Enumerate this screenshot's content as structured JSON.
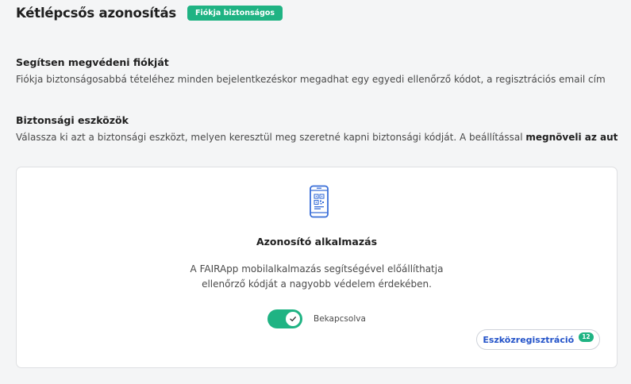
{
  "header": {
    "title": "Kétlépcsős azonosítás",
    "badge": "Fiókja biztonságos"
  },
  "section_protect": {
    "heading": "Segítsen megvédeni fiókját",
    "text": "Fiókja biztonságosabbá tételéhez minden bejelentkezéskor megadhat egy egyedi ellenőrző kódot, a regisztrációs email cím"
  },
  "section_tools": {
    "heading": "Biztonsági eszközök",
    "text": "Válassza ki azt a biztonsági eszközt, melyen keresztül meg szeretné kapni biztonsági kódját. A beállítással ",
    "text_bold": "megnöveli az aut"
  },
  "card": {
    "icon": "phone-qr-icon",
    "title": "Azonosító alkalmazás",
    "description_line1": "A FAIRApp mobilalkalmazás segítségével előállíthatja",
    "description_line2": "ellenőrző kódját a nagyobb védelem érdekében.",
    "toggle_state": "on",
    "toggle_label": "Bekapcsolva",
    "register_button_label": "Eszközregisztráció",
    "register_count": "12"
  },
  "colors": {
    "accent_green": "#1fb383",
    "link_blue": "#2353c9",
    "icon_blue": "#3a6fd8"
  }
}
